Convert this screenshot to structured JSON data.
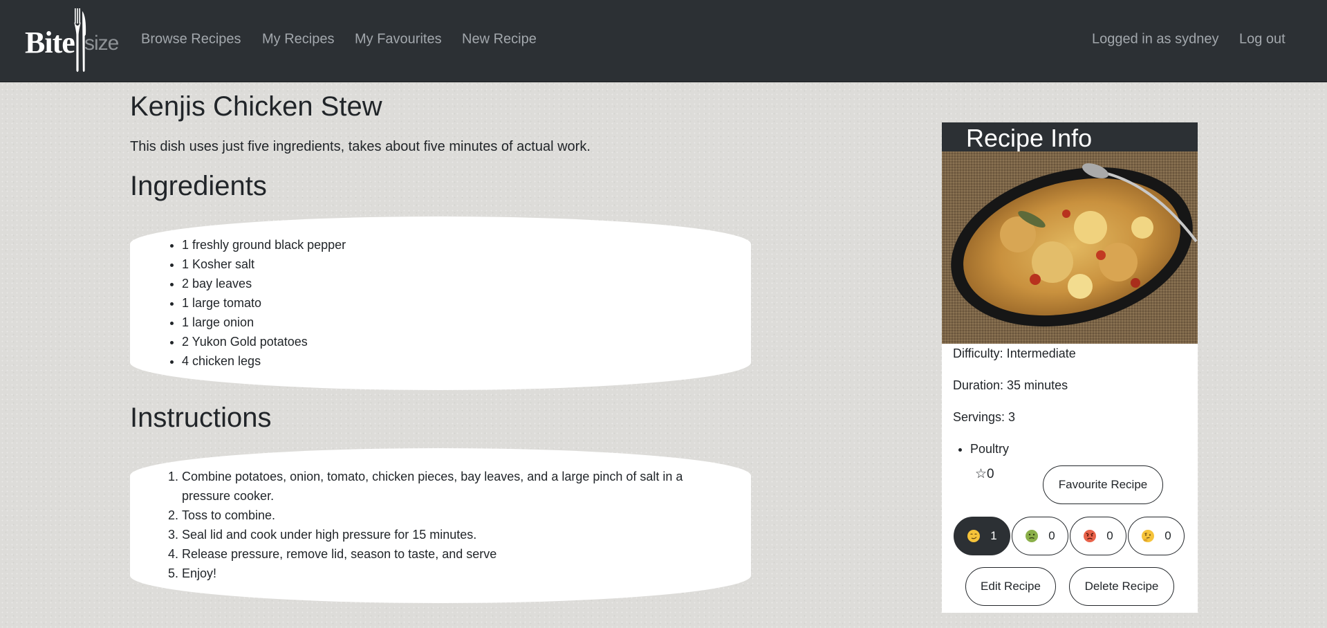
{
  "brand": {
    "bite": "Bite",
    "size": "size"
  },
  "nav": {
    "browse": "Browse Recipes",
    "my_recipes": "My Recipes",
    "favourites": "My Favourites",
    "new_recipe": "New Recipe",
    "logged_in": "Logged in as sydney",
    "logout": "Log out"
  },
  "recipe": {
    "title": "Kenjis Chicken Stew",
    "description": "This dish uses just five ingredients, takes about five minutes of actual work.",
    "ingredients_heading": "Ingredients",
    "ingredients": [
      "1 freshly ground black pepper",
      "1 Kosher salt",
      "2 bay leaves",
      "1 large tomato",
      "1 large onion",
      "2 Yukon Gold potatoes",
      "4 chicken legs"
    ],
    "instructions_heading": "Instructions",
    "instructions": [
      "Combine potatoes, onion, tomato, chicken pieces, bay leaves, and a large pinch of salt in a pressure cooker.",
      "Toss to combine.",
      "Seal lid and cook under high pressure for 15 minutes.",
      "Release pressure, remove lid, season to taste, and serve",
      "Enjoy!"
    ]
  },
  "info": {
    "heading": "Recipe Info",
    "difficulty": "Difficulty: Intermediate",
    "duration": "Duration: 35 minutes",
    "servings": "Servings: 3",
    "tags": [
      "Poultry"
    ],
    "stars": "☆0",
    "favourite_label": "Favourite Recipe",
    "reactions": [
      {
        "icon": "smirk-face-icon",
        "count": "1",
        "active": true
      },
      {
        "icon": "nauseated-face-icon",
        "count": "0",
        "active": false
      },
      {
        "icon": "angry-face-icon",
        "count": "0",
        "active": false
      },
      {
        "icon": "thinking-face-icon",
        "count": "0",
        "active": false
      }
    ],
    "edit_label": "Edit Recipe",
    "delete_label": "Delete Recipe"
  },
  "colors": {
    "navbar": "#2c3034",
    "nav_text": "#a3a8ad",
    "page_bg": "#dddcd9",
    "card_bg": "#ffffff",
    "text": "#212529"
  }
}
